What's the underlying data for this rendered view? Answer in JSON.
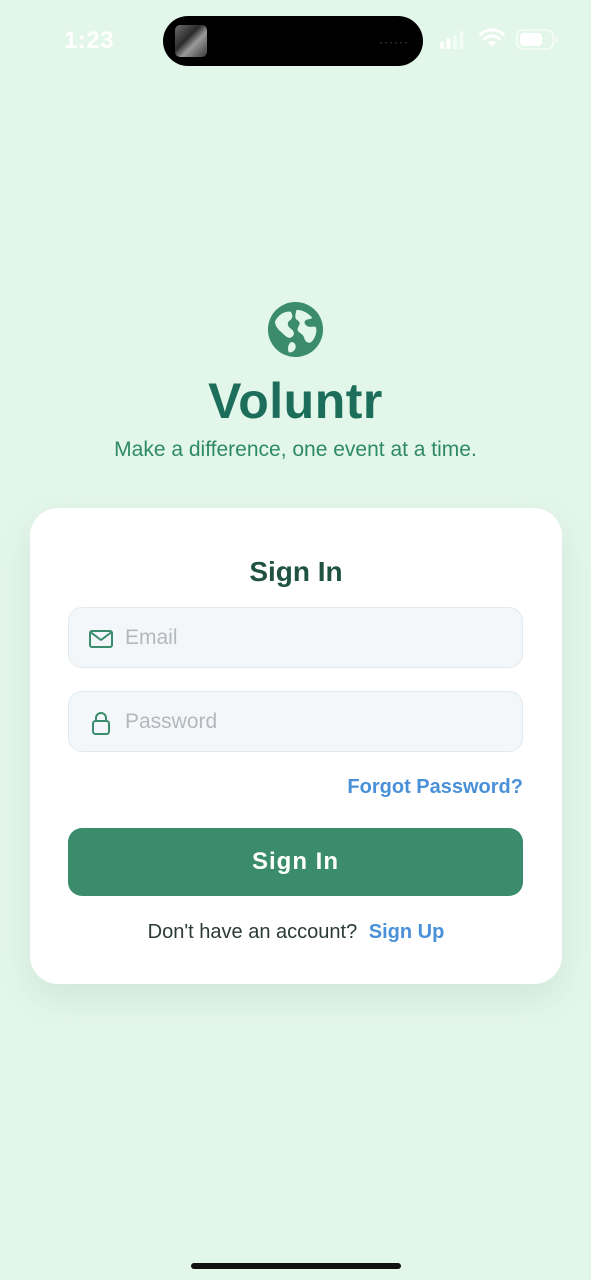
{
  "status_bar": {
    "time": "1:23",
    "island_dots": "······",
    "icons": [
      "signal-icon",
      "wifi-icon",
      "battery-icon"
    ]
  },
  "branding": {
    "logo_icon": "globe-icon",
    "app_name": "Voluntr",
    "tagline": "Make a difference, one event at a time."
  },
  "signin_card": {
    "title": "Sign In",
    "email_field": {
      "icon": "envelope-icon",
      "placeholder": "Email",
      "value": ""
    },
    "password_field": {
      "icon": "lock-icon",
      "placeholder": "Password",
      "value": ""
    },
    "forgot_password_label": "Forgot Password?",
    "submit_label": "Sign In",
    "signup_prompt": "Don't have an account?",
    "signup_link_label": "Sign Up"
  },
  "colors": {
    "background": "#e3f6ea",
    "brand_green": "#1c6e5b",
    "tagline_green": "#2e8a64",
    "button_green": "#3a8c6c",
    "link_blue": "#4a90d9",
    "card": "#ffffff"
  }
}
